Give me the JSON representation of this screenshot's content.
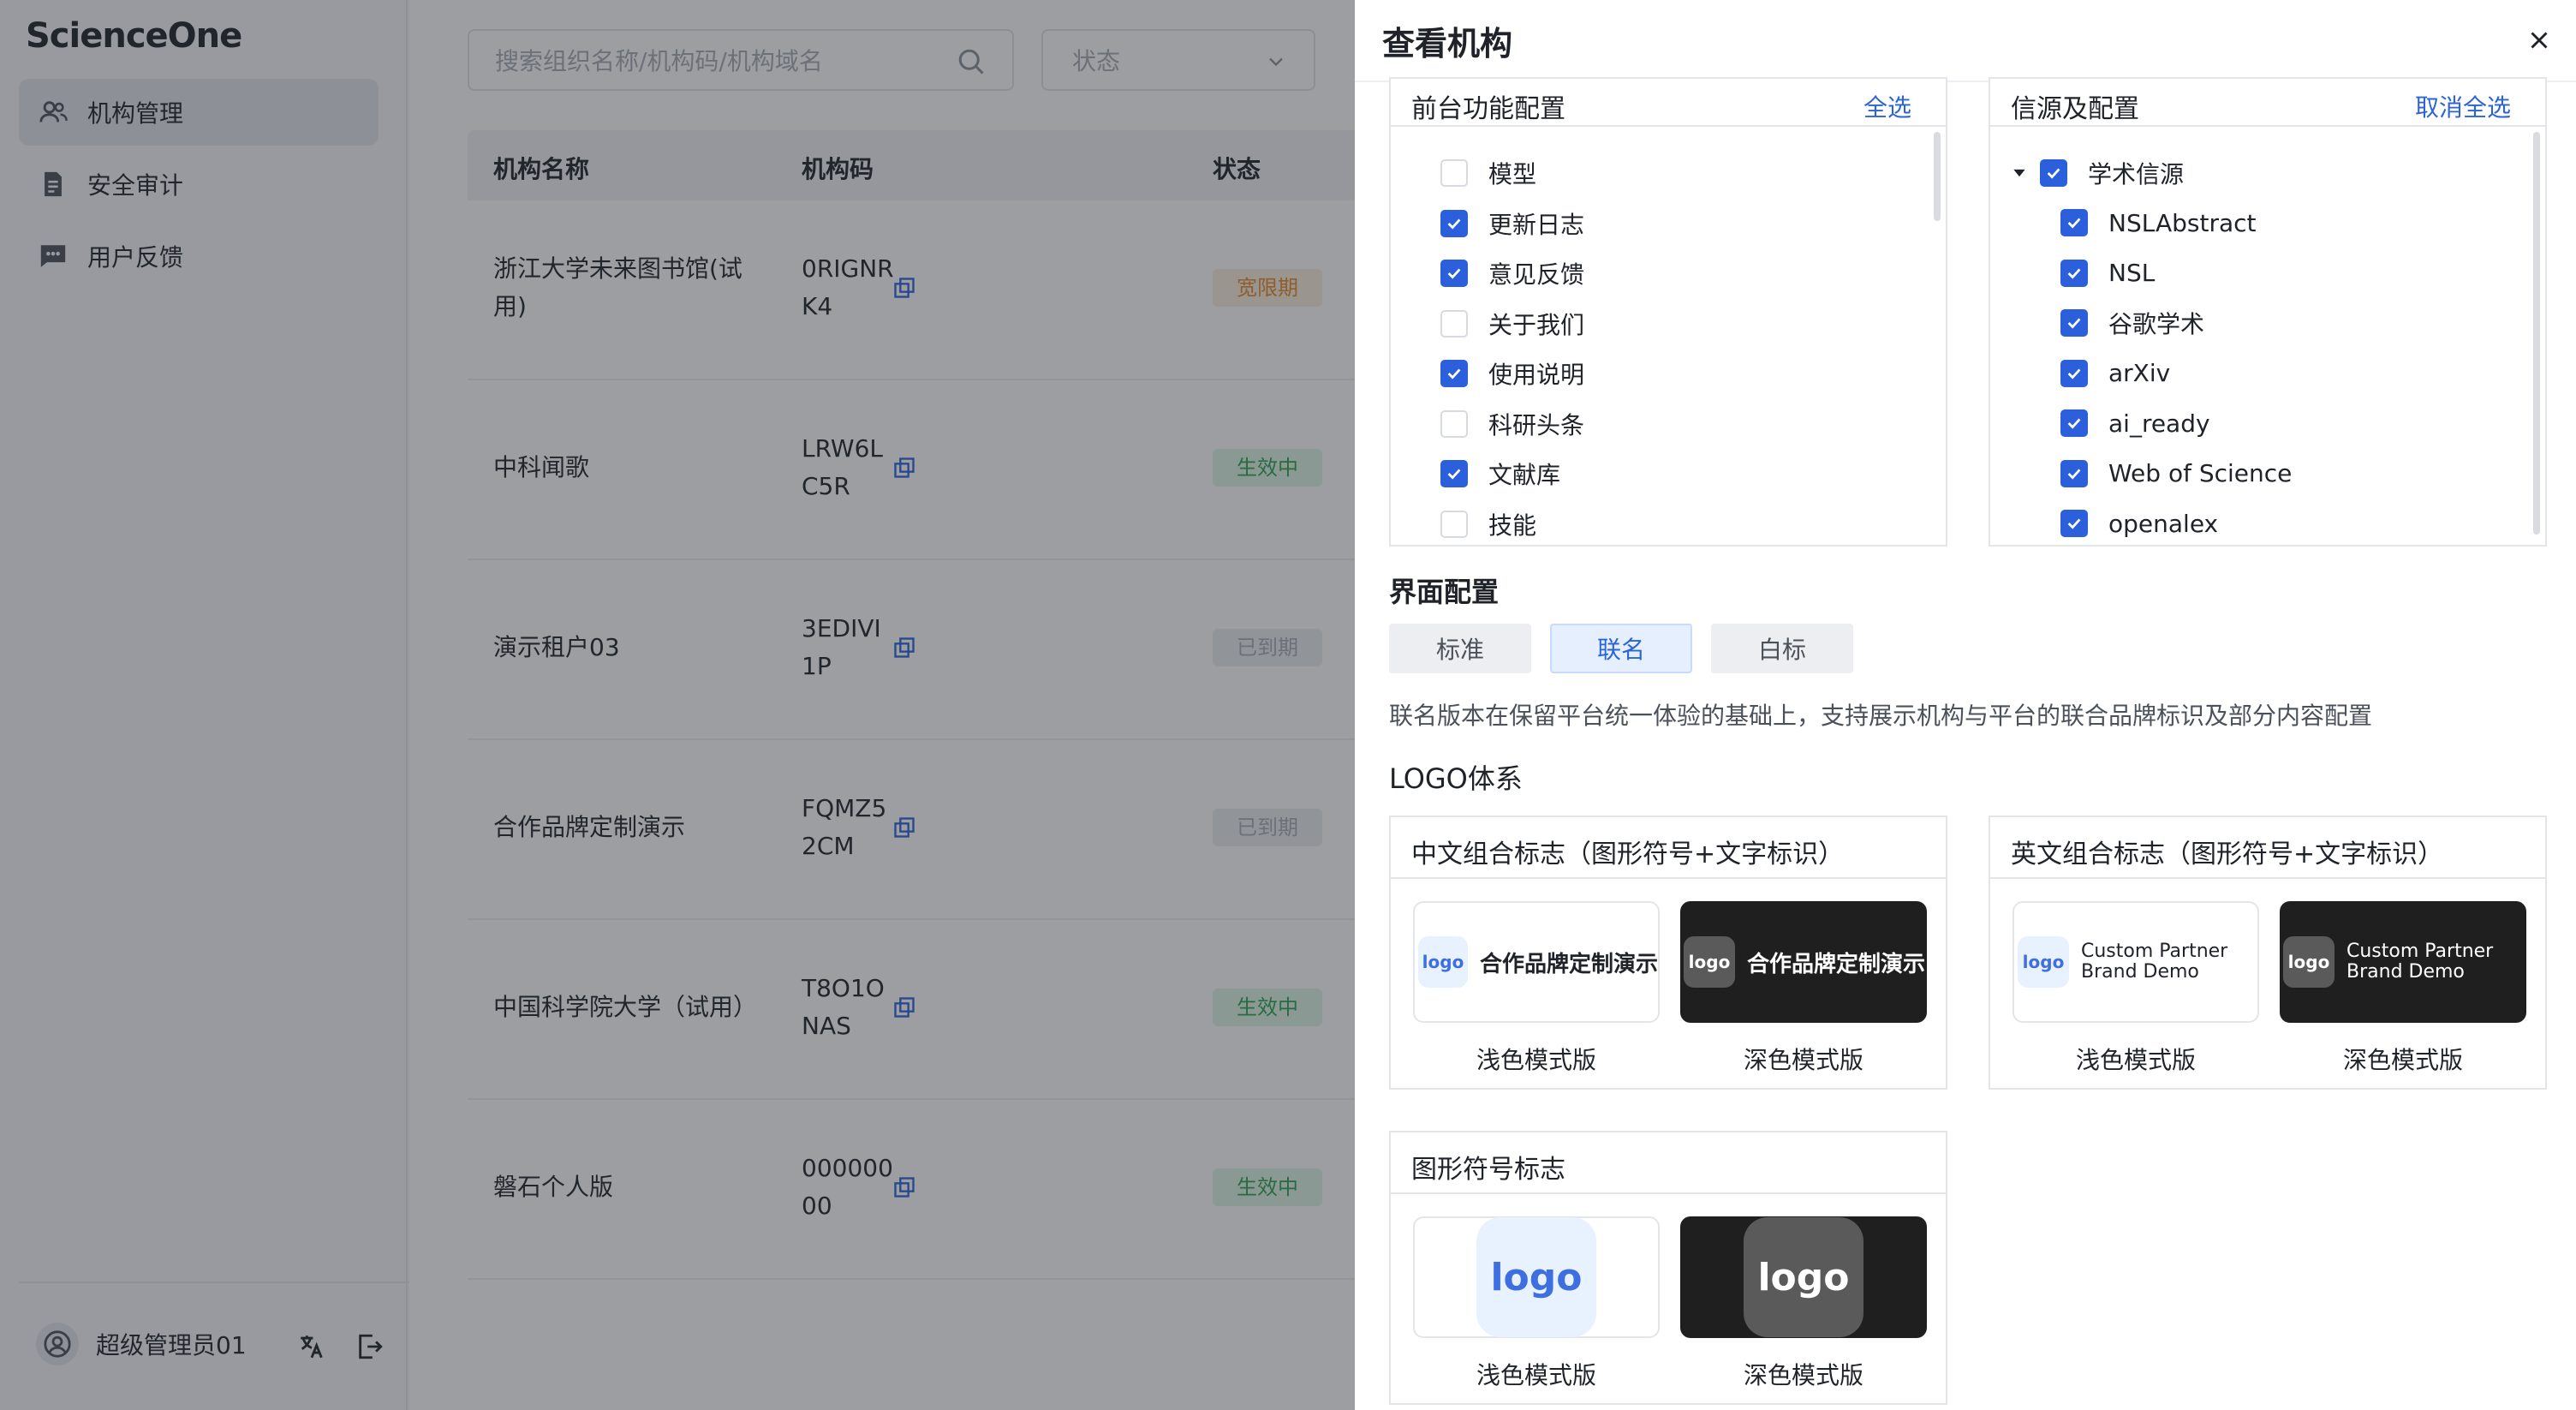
{
  "app": {
    "logo_text": "ScienceOne"
  },
  "sidebar": {
    "items": [
      {
        "label": "机构管理",
        "icon": "users-icon"
      },
      {
        "label": "安全审计",
        "icon": "audit-doc-icon"
      },
      {
        "label": "用户反馈",
        "icon": "chat-icon"
      }
    ],
    "user_name": "超级管理员01"
  },
  "list": {
    "search_placeholder": "搜索组织名称/机构码/机构域名",
    "status_placeholder": "状态",
    "headers": {
      "name": "机构名称",
      "code": "机构码",
      "status": "状态"
    },
    "rows": [
      {
        "name": "浙江大学未来图书馆(试用)",
        "code": "0RIGNRK4",
        "status": "宽限期"
      },
      {
        "name": "中科闻歌",
        "code": "LRW6LC5R",
        "status": "生效中"
      },
      {
        "name": "演示租户03",
        "code": "3EDIVI1P",
        "status": "已到期"
      },
      {
        "name": "合作品牌定制演示",
        "code": "FQMZ52CM",
        "status": "已到期"
      },
      {
        "name": "中国科学院大学（试用）",
        "code": "T8O1ONAS",
        "status": "生效中"
      },
      {
        "name": "磐石个人版",
        "code": "00000000",
        "status": "生效中"
      }
    ]
  },
  "drawer": {
    "title": "查看机构",
    "frontend_panel": {
      "title": "前台功能配置",
      "action": "全选",
      "items": [
        {
          "label": "模型",
          "checked": false
        },
        {
          "label": "更新日志",
          "checked": true
        },
        {
          "label": "意见反馈",
          "checked": true
        },
        {
          "label": "关于我们",
          "checked": false
        },
        {
          "label": "使用说明",
          "checked": true
        },
        {
          "label": "科研头条",
          "checked": false
        },
        {
          "label": "文献库",
          "checked": true
        },
        {
          "label": "技能",
          "checked": false
        }
      ]
    },
    "source_panel": {
      "title": "信源及配置",
      "action": "取消全选",
      "group": "学术信源",
      "items": [
        {
          "label": "NSLAbstract",
          "checked": true
        },
        {
          "label": "NSL",
          "checked": true
        },
        {
          "label": "谷歌学术",
          "checked": true
        },
        {
          "label": "arXiv",
          "checked": true
        },
        {
          "label": "ai_ready",
          "checked": true
        },
        {
          "label": "Web of Science",
          "checked": true
        },
        {
          "label": "openalex",
          "checked": true
        }
      ]
    },
    "ui_config": {
      "title": "界面配置",
      "options": [
        "标准",
        "联名",
        "白标"
      ],
      "selected": "联名",
      "description": "联名版本在保留平台统一体验的基础上，支持展示机构与平台的联合品牌标识及部分内容配置"
    },
    "logo_system": {
      "title": "LOGO体系",
      "cn_combo": {
        "title": "中文组合标志（图形符号+文字标识）",
        "mark": "logo",
        "brand": "合作品牌定制演示",
        "light_caption": "浅色模式版",
        "dark_caption": "深色模式版"
      },
      "en_combo": {
        "title": "英文组合标志（图形符号+文字标识）",
        "mark": "logo",
        "brand_line1": "Custom Partner",
        "brand_line2": "Brand Demo",
        "light_caption": "浅色模式版",
        "dark_caption": "深色模式版"
      },
      "symbol": {
        "title": "图形符号标志",
        "mark": "logo",
        "light_caption": "浅色模式版",
        "dark_caption": "深色模式版"
      }
    }
  },
  "colors": {
    "accent": "#2b5fdc",
    "link": "#2b63d9",
    "ok": "#2ea44f",
    "warn": "#e58a2a"
  }
}
